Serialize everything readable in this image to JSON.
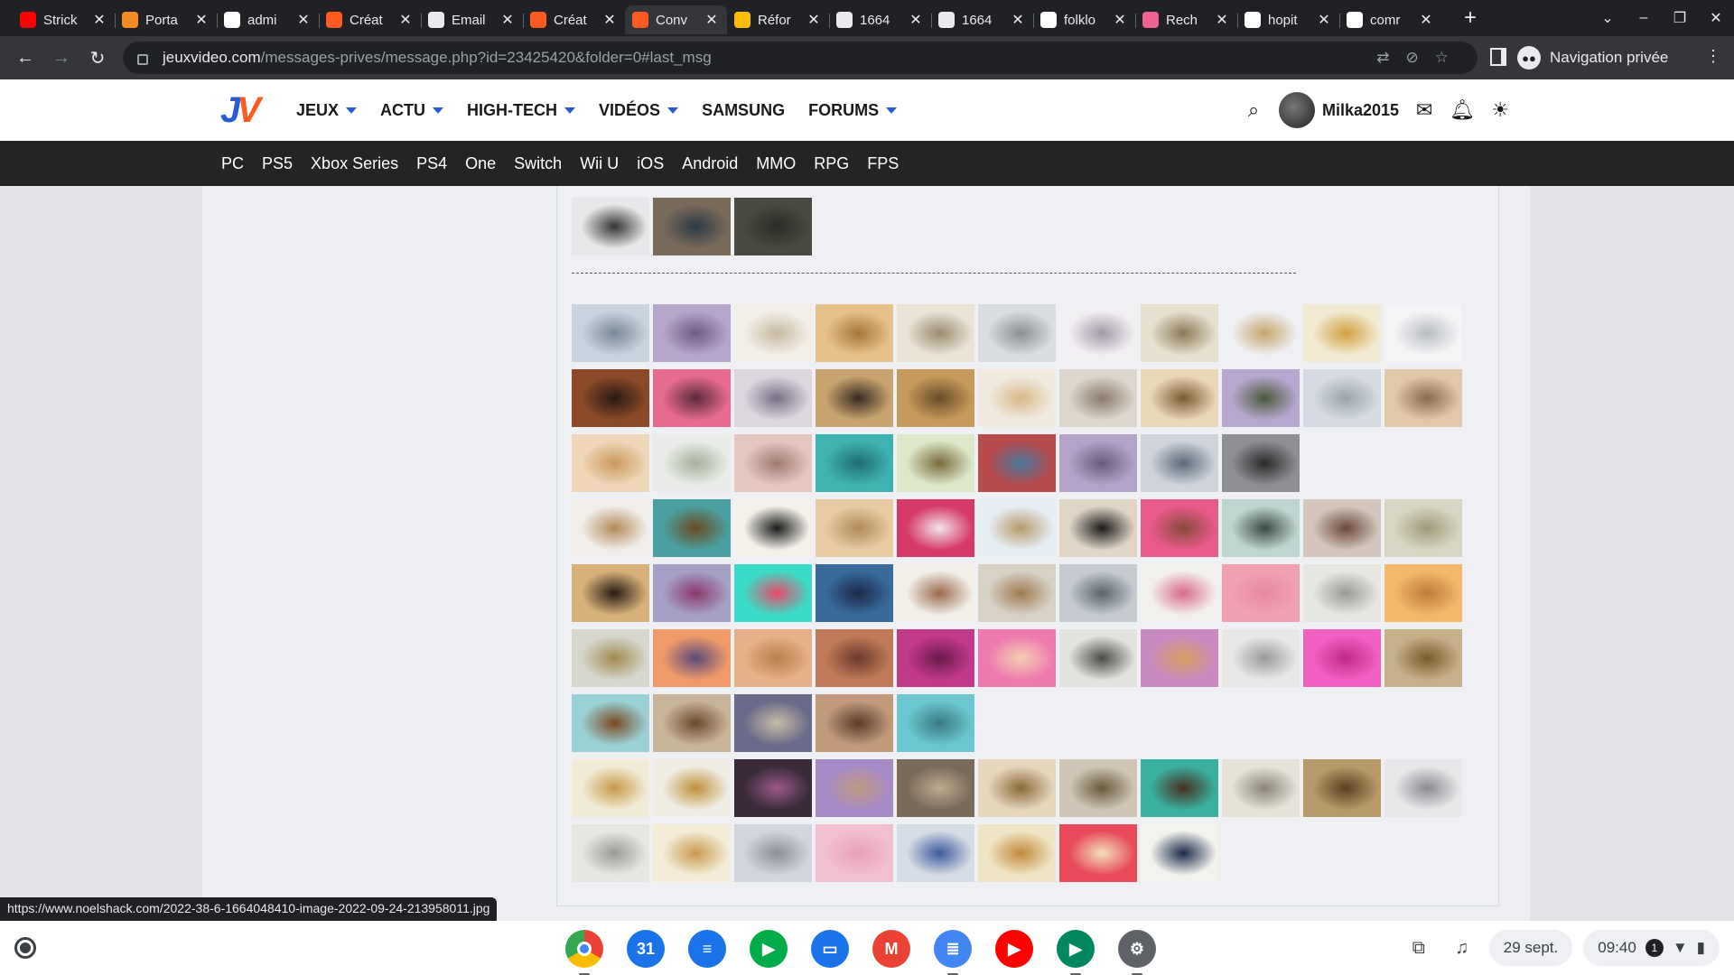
{
  "browser": {
    "tabs": [
      {
        "title": "Strick",
        "favicon": "youtube-icon",
        "color": "#ff0000"
      },
      {
        "title": "Porta",
        "favicon": "portal-icon",
        "color": "#f28b24"
      },
      {
        "title": "admi",
        "favicon": "google-icon",
        "color": "#ffffff"
      },
      {
        "title": "Créat",
        "favicon": "jv-icon",
        "color": "#ff5a1f"
      },
      {
        "title": "Email",
        "favicon": "email-icon",
        "color": "#e8eaed"
      },
      {
        "title": "Créat",
        "favicon": "jv-icon",
        "color": "#ff5a1f"
      },
      {
        "title": "Conv",
        "favicon": "jv-icon",
        "color": "#ff5a1f",
        "active": true
      },
      {
        "title": "Réfor",
        "favicon": "reform-icon",
        "color": "#fbbc04"
      },
      {
        "title": "1664",
        "favicon": "globe-icon",
        "color": "#e8eaed"
      },
      {
        "title": "1664",
        "favicon": "globe-icon",
        "color": "#e8eaed"
      },
      {
        "title": "folklo",
        "favicon": "google-icon",
        "color": "#ffffff"
      },
      {
        "title": "Rech",
        "favicon": "search-app-icon",
        "color": "#f06292"
      },
      {
        "title": "hopit",
        "favicon": "google-icon",
        "color": "#ffffff"
      },
      {
        "title": "comr",
        "favicon": "google-icon",
        "color": "#ffffff"
      }
    ],
    "url_host": "jeuxvideo.com",
    "url_path": "/messages-prives/message.php?id=23425420&folder=0#last_msg",
    "incognito_label": "Navigation privée",
    "status_url": "https://www.noelshack.com/2022-38-6-1664048410-image-2022-09-24-213958011.jpg"
  },
  "site": {
    "logo_j": "J",
    "logo_v": "V",
    "nav": [
      "JEUX",
      "ACTU",
      "HIGH-TECH",
      "VIDÉOS",
      "SAMSUNG",
      "FORUMS"
    ],
    "nav_has_caret": [
      true,
      true,
      true,
      true,
      false,
      true
    ],
    "username": "Milka2015",
    "platforms": [
      "PC",
      "PS5",
      "Xbox Series",
      "PS4",
      "One",
      "Switch",
      "Wii U",
      "iOS",
      "Android",
      "MMO",
      "RPG",
      "FPS"
    ],
    "brand_blue": "#2a5cd8",
    "brand_orange": "#ff5a1f"
  },
  "message": {
    "top_images": [
      [
        "#e8e8ea",
        "#333333"
      ],
      [
        "#7a6a5a",
        "#2c3a44"
      ],
      [
        "#4a4a40",
        "#2a2a26"
      ]
    ],
    "divider": "----------------------------------------------------------------------------------------------------------------------------------------------------------------------------------",
    "gallery_rows": [
      [
        [
          "#c9d3df",
          "#7a8899"
        ],
        [
          "#b7a6cc",
          "#6f5a86"
        ],
        [
          "#f3efe8",
          "#c8b9a0"
        ],
        [
          "#e6c28a",
          "#a5773a"
        ],
        [
          "#eae3d6",
          "#9b8b6e"
        ],
        [
          "#d9dde2",
          "#8b8f93"
        ],
        [
          "#f2eff3",
          "#a29aa8"
        ],
        [
          "#e7e0cf",
          "#8d7a55"
        ],
        [
          "#eef0f3",
          "#c6a46b"
        ],
        [
          "#f3ead2",
          "#d0a040"
        ],
        [
          "#f4f5f6",
          "#b9bcc2"
        ]
      ],
      [
        [
          "#8a4a2a",
          "#2a1a10"
        ],
        [
          "#e66b8e",
          "#5a2a3a"
        ],
        [
          "#dcd6df",
          "#7a6f86"
        ],
        [
          "#c8a470",
          "#3a2a20"
        ],
        [
          "#c59a5a",
          "#6a4a2a"
        ],
        [
          "#f1eadf",
          "#d8b98a"
        ],
        [
          "#dcd6cc",
          "#8a7a6a"
        ],
        [
          "#e9d7b6",
          "#7a5a30"
        ],
        [
          "#b7a7d0",
          "#4a5a3a"
        ],
        [
          "#d6dbe1",
          "#9aa3ab"
        ],
        [
          "#e3c8a8",
          "#8a6a4a"
        ]
      ],
      [
        [
          "#f0d6b8",
          "#c99a60"
        ],
        [
          "#e9ece8",
          "#a8b09a"
        ],
        [
          "#e6c6c0",
          "#a07a70"
        ],
        [
          "#3fb3b1",
          "#1e6e70"
        ],
        [
          "#dce8c8",
          "#7a6a3a"
        ],
        [
          "#b84a4a",
          "#4a7aa0"
        ],
        [
          "#b3a3c6",
          "#6a5a7a"
        ],
        [
          "#cfd3dc",
          "#5a6a7a"
        ],
        [
          "#8d8f93",
          "#2a2a2a"
        ]
      ],
      [
        [
          "#f1ede8",
          "#b58a5a"
        ],
        [
          "#4aa0a0",
          "#6a4a20"
        ],
        [
          "#f4f1ea",
          "#1a1a1a"
        ],
        [
          "#e8caa4",
          "#b08a5a"
        ],
        [
          "#d63a6a",
          "#f2e6ea"
        ],
        [
          "#e6eef4",
          "#b89a6a"
        ],
        [
          "#e0d6c6",
          "#1a1a1a"
        ],
        [
          "#e85a8a",
          "#8a4a3a"
        ],
        [
          "#bfd6d0",
          "#3a4a44"
        ],
        [
          "#d4c6bc",
          "#6a4a3a"
        ],
        [
          "#d8d6c2",
          "#a09a7a"
        ]
      ],
      [
        [
          "#d6b27a",
          "#2a1a14"
        ],
        [
          "#a6a0c6",
          "#8a3a6a"
        ],
        [
          "#3adcc8",
          "#e84a6a"
        ],
        [
          "#3a6a9a",
          "#1a2a4a"
        ],
        [
          "#f2eee8",
          "#9a6a4a"
        ],
        [
          "#d8d2c6",
          "#a07a50"
        ],
        [
          "#c6cbd2",
          "#5a626a"
        ],
        [
          "#f2f0ec",
          "#d86a8a"
        ],
        [
          "#f0a0b0",
          "#e88aa0"
        ],
        [
          "#e6e6e2",
          "#9a9a96"
        ],
        [
          "#f3b86a",
          "#c07a3a"
        ]
      ],
      [
        [
          "#d6d6cc",
          "#a08a50"
        ],
        [
          "#f09a6a",
          "#5a4a7a"
        ],
        [
          "#e6b08a",
          "#b8804a"
        ],
        [
          "#c07a5a",
          "#6a3a2a"
        ],
        [
          "#c23a8a",
          "#6a1a4a"
        ],
        [
          "#f07ab0",
          "#f2d0b0"
        ],
        [
          "#e2e2de",
          "#4a4a48"
        ],
        [
          "#c88ac0",
          "#d8a060"
        ],
        [
          "#e8e8e6",
          "#9a9a98"
        ],
        [
          "#f060c0",
          "#c02a8a"
        ],
        [
          "#c6b08a",
          "#7a5a2a"
        ]
      ],
      [
        [
          "#9ad0d6",
          "#7a4a20"
        ],
        [
          "#c8b49a",
          "#6a4a2a"
        ],
        [
          "#6a6a8a",
          "#c8bca6"
        ],
        [
          "#c09a7a",
          "#5a3a2a"
        ],
        [
          "#6ac6d0",
          "#3a7a80"
        ]
      ],
      [
        [
          "#f2ecd6",
          "#c89a4a"
        ],
        [
          "#f0ede4",
          "#c0903a"
        ],
        [
          "#3a2a3a",
          "#9a5a8a"
        ],
        [
          "#a68ac6",
          "#c09a80"
        ],
        [
          "#7a6a5a",
          "#c0aa90"
        ],
        [
          "#e6d6bc",
          "#8a6a3a"
        ],
        [
          "#cfc6b6",
          "#6a5a3a"
        ],
        [
          "#3ab0a0",
          "#4a3020"
        ],
        [
          "#e6e2d8",
          "#8a8478"
        ],
        [
          "#b89a6a",
          "#5a4020"
        ],
        [
          "#e8e8ea",
          "#8a8a90"
        ]
      ],
      [
        [
          "#e6e6e2",
          "#9a9a96"
        ],
        [
          "#f4ecd6",
          "#c89a50"
        ],
        [
          "#d2d6dc",
          "#8a8e96"
        ],
        [
          "#f0c0d0",
          "#e8a0b8"
        ],
        [
          "#d6dce6",
          "#3a5a9a"
        ],
        [
          "#f0e4c6",
          "#c08a3a"
        ],
        [
          "#e84a5a",
          "#f2e2b6"
        ],
        [
          "#f2f2ee",
          "#1a2a4a"
        ]
      ]
    ]
  },
  "shelf": {
    "apps": [
      {
        "name": "chrome",
        "color": "#4285f4",
        "glyph": "",
        "running": true
      },
      {
        "name": "calendar",
        "color": "#1a73e8",
        "glyph": "31",
        "running": false
      },
      {
        "name": "messages",
        "color": "#1a73e8",
        "glyph": "≡",
        "running": false
      },
      {
        "name": "meet",
        "color": "#00ac47",
        "glyph": "▶",
        "running": false
      },
      {
        "name": "files",
        "color": "#1a73e8",
        "glyph": "▭",
        "running": false
      },
      {
        "name": "gmail",
        "color": "#ea4335",
        "glyph": "M",
        "running": false
      },
      {
        "name": "docs",
        "color": "#4285f4",
        "glyph": "≣",
        "running": true
      },
      {
        "name": "youtube",
        "color": "#ff0000",
        "glyph": "▶",
        "running": false
      },
      {
        "name": "play-store",
        "color": "#01875f",
        "glyph": "▶",
        "running": true
      },
      {
        "name": "settings",
        "color": "#5f6368",
        "glyph": "⚙",
        "running": true
      }
    ],
    "date": "29 sept.",
    "time": "09:40",
    "notification_count": "1"
  }
}
